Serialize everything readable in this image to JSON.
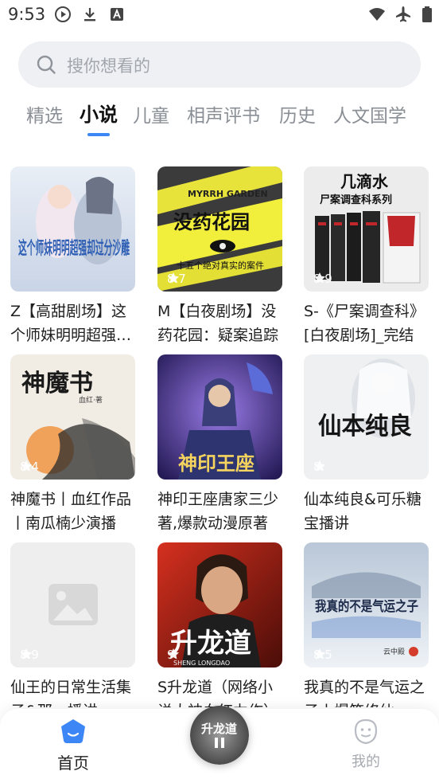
{
  "status_bar": {
    "time": "9:53",
    "left_icons": [
      "play-circle-icon",
      "download-icon",
      "font-a-icon"
    ],
    "right_icons": [
      "wifi-icon",
      "airplane-mode-icon",
      "battery-icon"
    ]
  },
  "search": {
    "placeholder": "搜你想看的"
  },
  "tabs": [
    {
      "label": "精选",
      "active": false
    },
    {
      "label": "小说",
      "active": true
    },
    {
      "label": "儿童",
      "active": false
    },
    {
      "label": "相声评书",
      "active": false
    },
    {
      "label": "历史",
      "active": false
    },
    {
      "label": "人文国学",
      "active": false
    }
  ],
  "colors": {
    "accent": "#3d86f5",
    "tab_inactive": "#8a8f96",
    "search_bg": "#eef0f4"
  },
  "books": [
    {
      "title": "Z【高甜剧场】这个师妹明明超强却过分沙雕",
      "rating": "",
      "cover_text": "这个师妹明明超强却过分沙雕"
    },
    {
      "title": "M【白夜剧场】没药花园：疑案追踪",
      "rating": "8.7",
      "cover_text": "没药花园",
      "cover_subtext": "MYRRH GARDEN",
      "cover_caption": "十五个绝对真实的案件"
    },
    {
      "title": "S-《尸案调查科》[白夜剧场]_完结",
      "rating": "8.9",
      "cover_text": "几滴水",
      "cover_subtext": "尸案调查科系列"
    },
    {
      "title": "神魔书丨血红作品丨南瓜楠少演播",
      "rating": "8.4",
      "cover_text": "神魔书",
      "cover_subtext": "血红·著"
    },
    {
      "title": "神印王座唐家三少著,爆款动漫原著",
      "rating": "",
      "cover_text": "神印王座"
    },
    {
      "title": "仙本纯良&可乐糖宝播讲",
      "rating": "8.",
      "cover_text": "仙本纯良"
    },
    {
      "title": "仙王的日常生活集子&那一播讲",
      "rating": "8.9",
      "cover_text": ""
    },
    {
      "title": "S升龙道（网络小说大神血红力作）",
      "rating": "9",
      "cover_text": "升龙道",
      "cover_subtext": "SHENG LONGDAO"
    },
    {
      "title": "我真的不是气运之子丨爆笑修仙",
      "rating": "8.5",
      "cover_text": "我真的不是气运之子",
      "cover_subtext": "云中殿"
    }
  ],
  "bottom_nav": {
    "home_label": "首页",
    "mine_label": "我的",
    "player_cover_text": "升龙道"
  }
}
